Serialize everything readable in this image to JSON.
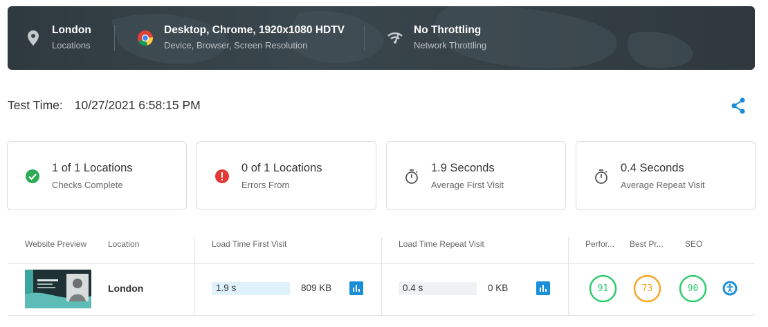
{
  "banner": {
    "location": {
      "title": "London",
      "subtitle": "Locations",
      "icon": "map-pin-icon"
    },
    "device": {
      "title": "Desktop, Chrome, 1920x1080 HDTV",
      "subtitle": "Device, Browser, Screen Resolution",
      "icon": "chrome-icon"
    },
    "network": {
      "title": "No Throttling",
      "subtitle": "Network Throttling",
      "icon": "signal-icon"
    }
  },
  "test_time": {
    "label": "Test Time:",
    "value": "10/27/2021 6:58:15 PM"
  },
  "cards": [
    {
      "value": "1 of 1 Locations",
      "label": "Checks Complete",
      "icon": "check-circle-icon",
      "color": "#2eab55"
    },
    {
      "value": "0 of 1 Locations",
      "label": "Errors From",
      "icon": "error-circle-icon",
      "color": "#e53935"
    },
    {
      "value": "1.9 Seconds",
      "label": "Average First Visit",
      "icon": "stopwatch-icon"
    },
    {
      "value": "0.4 Seconds",
      "label": "Average Repeat Visit",
      "icon": "stopwatch-icon"
    }
  ],
  "table": {
    "headers": {
      "preview": "Website Preview",
      "location": "Location",
      "first": "Load Time First Visit",
      "repeat": "Load Time Repeat Visit",
      "perf": "Perfor...",
      "best": "Best Pr...",
      "seo": "SEO"
    },
    "rows": [
      {
        "location": "London",
        "first_time": "1.9 s",
        "first_size": "809 KB",
        "repeat_time": "0.4 s",
        "repeat_size": "0 KB",
        "performance": "91",
        "best_practices": "73",
        "seo": "90"
      }
    ]
  },
  "colors": {
    "accent": "#1a8fd8",
    "good": "#2ecc71",
    "average": "#f5a623",
    "first_bar": "#dff1fb",
    "repeat_bar": "#f0f1f2"
  }
}
